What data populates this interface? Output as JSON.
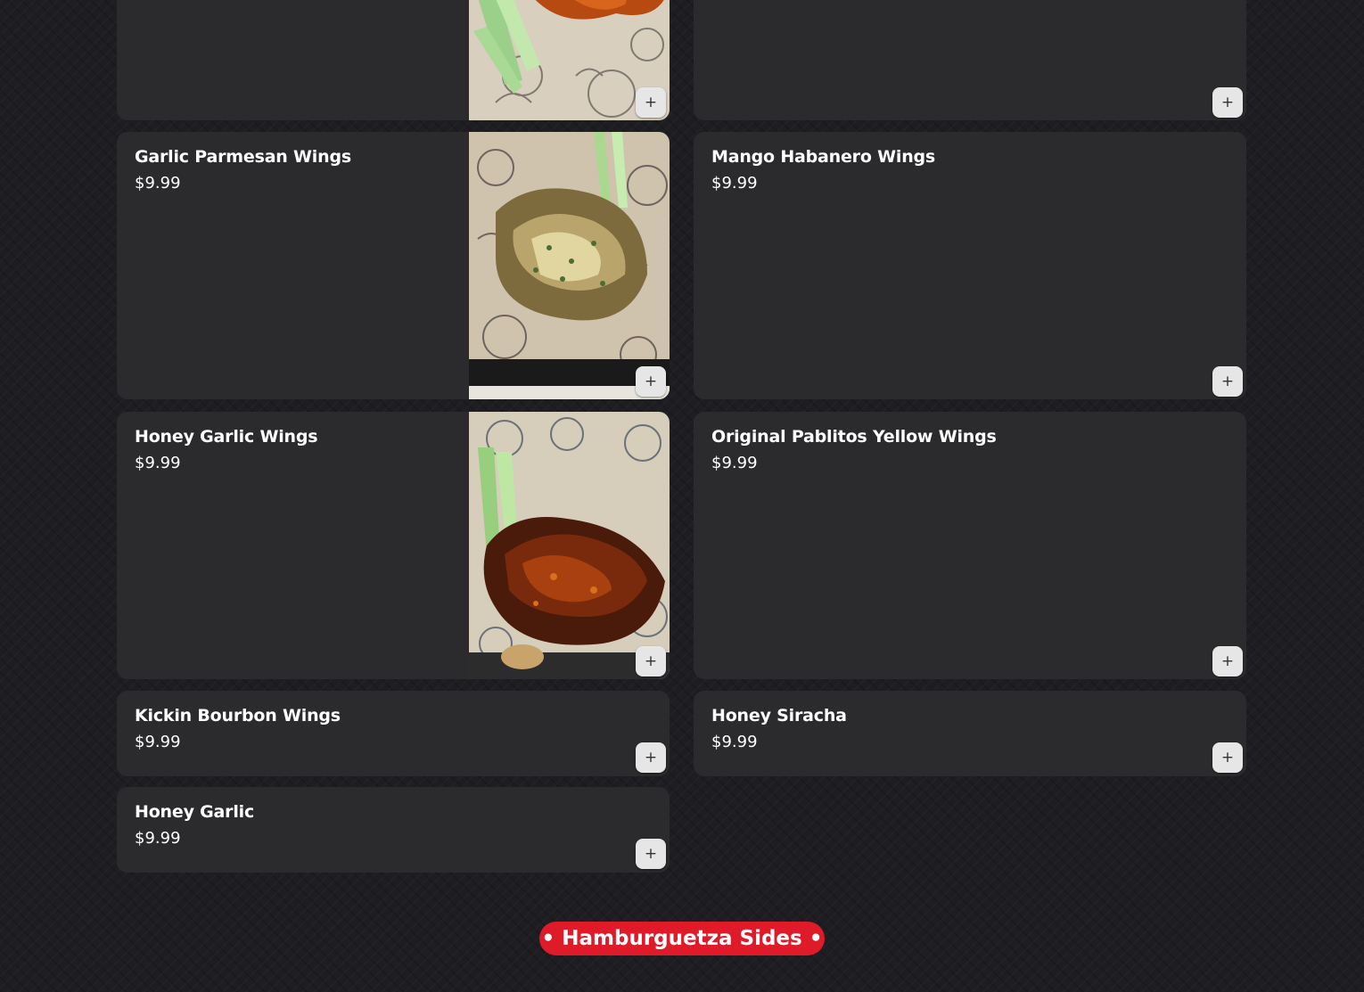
{
  "colors": {
    "background": "#1e1d22",
    "card": "#2b2b2d",
    "text": "#ffffff",
    "add_button": "#e6e6e6",
    "section_pill": "#df1b29"
  },
  "add_icon": "plus-icon",
  "add_label": "+",
  "menu_items": [
    {
      "title": "",
      "price": "",
      "has_image": true,
      "image": "wings-hot-sauce-celery-photo"
    },
    {
      "title": "",
      "price": "",
      "has_image": false
    },
    {
      "title": "Garlic Parmesan Wings",
      "price": "$9.99",
      "has_image": true,
      "image": "garlic-parmesan-wings-photo"
    },
    {
      "title": "Mango Habanero Wings",
      "price": "$9.99",
      "has_image": false
    },
    {
      "title": "Honey Garlic Wings",
      "price": "$9.99",
      "has_image": true,
      "image": "honey-garlic-wings-photo"
    },
    {
      "title": "Original Pablitos Yellow Wings",
      "price": "$9.99",
      "has_image": false
    },
    {
      "title": "Kickin Bourbon Wings",
      "price": "$9.99",
      "has_image": false
    },
    {
      "title": "Honey Siracha",
      "price": "$9.99",
      "has_image": false
    },
    {
      "title": "Honey Garlic",
      "price": "$9.99",
      "has_image": false
    }
  ],
  "next_section": {
    "label": "• Hamburguetza Sides •"
  }
}
